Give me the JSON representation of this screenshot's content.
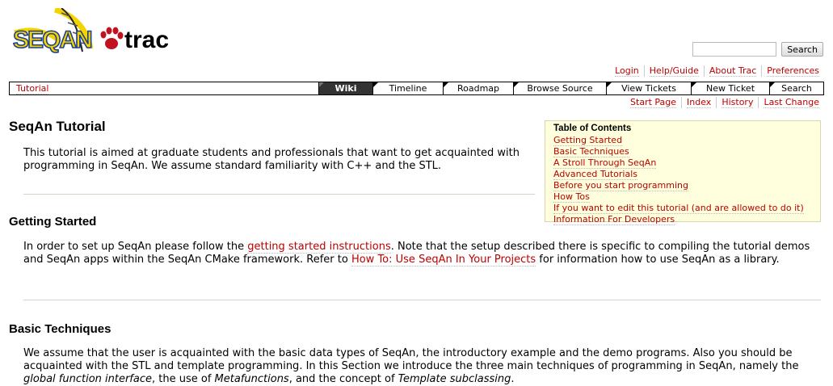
{
  "header": {
    "logo": {
      "seqan_text": "SEQAN",
      "trac_text": "trac"
    },
    "search": {
      "placeholder": "",
      "button_label": "Search"
    }
  },
  "metanav": [
    {
      "label": "Login"
    },
    {
      "label": "Help/Guide"
    },
    {
      "label": "About Trac"
    },
    {
      "label": "Preferences"
    }
  ],
  "mainnav": {
    "context_label": "Tutorial",
    "tabs": [
      {
        "label": "Wiki",
        "active": true
      },
      {
        "label": "Timeline"
      },
      {
        "label": "Roadmap"
      },
      {
        "label": "Browse Source"
      },
      {
        "label": "View Tickets"
      },
      {
        "label": "New Ticket"
      },
      {
        "label": "Search"
      }
    ]
  },
  "ctxtnav": [
    {
      "label": "Start Page"
    },
    {
      "label": "Index"
    },
    {
      "label": "History"
    },
    {
      "label": "Last Change"
    }
  ],
  "page": {
    "title": "SeqAn Tutorial",
    "intro": "This tutorial is aimed at graduate students and professionals that want to get acquainted with programming in SeqAn. We assume standard familiarity with C++ and the STL.",
    "sections": {
      "getting_started": {
        "heading": "Getting Started",
        "text_1": "In order to set up SeqAn please follow the ",
        "link_1": "getting started instructions",
        "text_2": ". Note that the setup described there is specific to compiling the tutorial demos and SeqAn apps within the SeqAn CMake framework. Refer to ",
        "link_2": "How To: Use SeqAn In Your Projects",
        "text_3": " for information how to use SeqAn as a library."
      },
      "basic_techniques": {
        "heading": "Basic Techniques",
        "text_1": "We assume that the user is acquainted with the basic data types of SeqAn, the introductory example and the demo programs. Also you should be acquainted with the STL and template programming. In this Section we introduce the three main techniques of programming in SeqAn, namely the ",
        "em_1": "global function interface",
        "text_2": ", the use of ",
        "em_2": "Metafunctions",
        "text_3": ", and the concept of ",
        "em_3": "Template subclassing",
        "text_4": "."
      }
    }
  },
  "toc": {
    "title": "Table of Contents",
    "items": [
      {
        "label": "Getting Started"
      },
      {
        "label": "Basic Techniques"
      },
      {
        "label": "A Stroll Through SeqAn"
      },
      {
        "label": "Advanced Tutorials"
      },
      {
        "label": "Before you start programming"
      },
      {
        "label": "How Tos"
      },
      {
        "label": "If you want to edit this tutorial (and are allowed to do it)"
      },
      {
        "label": "Information For Developers"
      }
    ]
  },
  "colors": {
    "link": "#bb0000",
    "toc_background": "#ffffdd",
    "active_tab": "#333333",
    "logo_yellow": "#f4d400",
    "logo_blue": "#1f3f8f",
    "paw_red": "#c1121f"
  }
}
